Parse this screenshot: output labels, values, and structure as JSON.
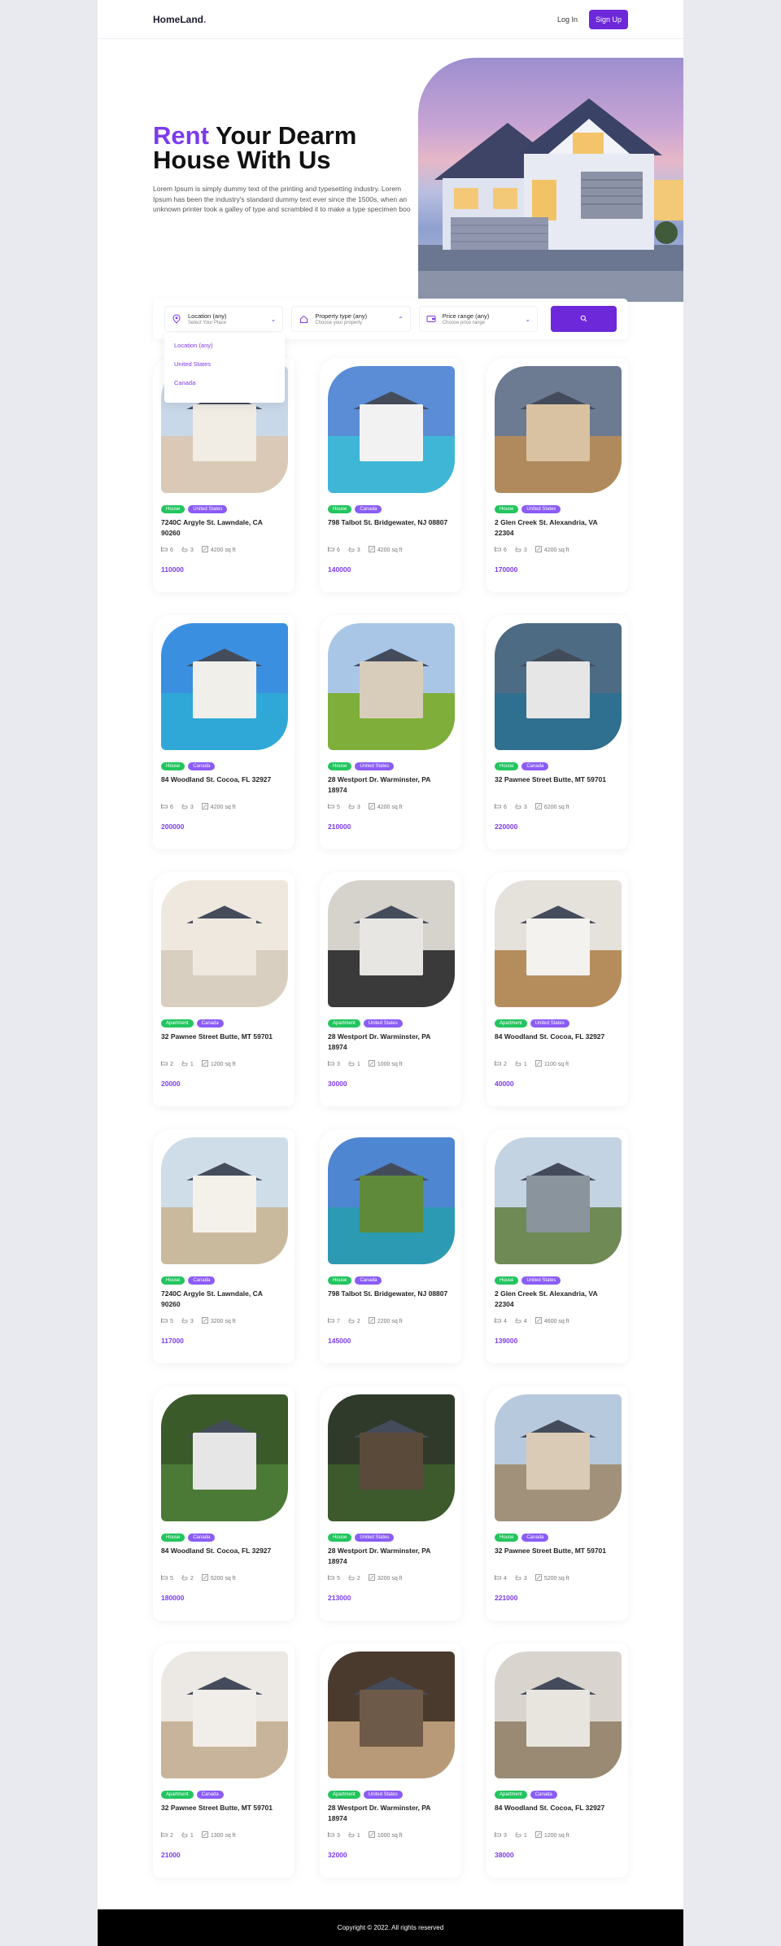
{
  "header": {
    "logo": "HomeLand",
    "logo_dot": ".",
    "login": "Log In",
    "signup": "Sign Up"
  },
  "hero": {
    "title_accent": "Rent",
    "title_rest": " Your Dearm",
    "title_line2": "House With Us",
    "description": "Lorem Ipsum is simply dummy text of the printing and typesetting industry. Lorem Ipsum has been the industry's standard dummy text ever since the 1500s, when an unknown printer took a galley of type and scrambled it to make a type specimen boo"
  },
  "search": {
    "location": {
      "label": "Location (any)",
      "sub": "Select Your Place"
    },
    "property": {
      "label": "Property type (any)",
      "sub": "Choose your property"
    },
    "price": {
      "label": "Price range (any)",
      "sub": "Choose price range"
    },
    "location_options": [
      "Location (any)",
      "United States",
      "Canada"
    ]
  },
  "listings": [
    {
      "type": "House",
      "country": "United States",
      "address": "7240C Argyle St. Lawndale, CA 90260",
      "beds": "6",
      "baths": "3",
      "area": "4200 sq ft",
      "price": "110000",
      "sky": "#c9d8e8",
      "ground": "#d9c9b6",
      "wall": "#f1ece4"
    },
    {
      "type": "House",
      "country": "Canada",
      "address": "798 Talbot St. Bridgewater, NJ 08807",
      "beds": "6",
      "baths": "3",
      "area": "4200 sq ft",
      "price": "140000",
      "sky": "#5b8dd6",
      "ground": "#3fb6d6",
      "wall": "#f2f2f2"
    },
    {
      "type": "House",
      "country": "United States",
      "address": "2 Glen Creek St. Alexandria, VA 22304",
      "beds": "6",
      "baths": "3",
      "area": "4200 sq ft",
      "price": "170000",
      "sky": "#6c7a92",
      "ground": "#b08a5c",
      "wall": "#d9c2a1"
    },
    {
      "type": "House",
      "country": "Canada",
      "address": "84 Woodland St. Cocoa, FL 32927",
      "beds": "6",
      "baths": "3",
      "area": "4200 sq ft",
      "price": "200000",
      "sky": "#3b8fe0",
      "ground": "#2fa8d8",
      "wall": "#f0efea"
    },
    {
      "type": "House",
      "country": "United States",
      "address": "28 Westport Dr. Warminster, PA 18974",
      "beds": "5",
      "baths": "3",
      "area": "4200 sq ft",
      "price": "210000",
      "sky": "#a9c6e6",
      "ground": "#7fae3a",
      "wall": "#d8cdbb"
    },
    {
      "type": "House",
      "country": "Canada",
      "address": "32 Pawnee Street Butte, MT 59701",
      "beds": "6",
      "baths": "3",
      "area": "6200 sq ft",
      "price": "220000",
      "sky": "#4e6b84",
      "ground": "#2f6f8f",
      "wall": "#e6e6e6"
    },
    {
      "type": "Apartment",
      "country": "Canada",
      "address": "32 Pawnee Street Butte, MT 59701",
      "beds": "2",
      "baths": "1",
      "area": "1200 sq ft",
      "price": "20000",
      "sky": "#efe8df",
      "ground": "#d9cfc1",
      "wall": "#efe8df"
    },
    {
      "type": "Apartment",
      "country": "United States",
      "address": "28 Westport Dr. Warminster, PA 18974",
      "beds": "3",
      "baths": "1",
      "area": "1000 sq ft",
      "price": "30000",
      "sky": "#d6d2cc",
      "ground": "#3a3a3a",
      "wall": "#e8e6e2"
    },
    {
      "type": "Apartment",
      "country": "United States",
      "address": "84 Woodland St. Cocoa, FL 32927",
      "beds": "2",
      "baths": "1",
      "area": "1100 sq ft",
      "price": "40000",
      "sky": "#e5e1db",
      "ground": "#b58d5d",
      "wall": "#f4f2ee"
    },
    {
      "type": "House",
      "country": "Canada",
      "address": "7240C Argyle St. Lawndale, CA 90260",
      "beds": "5",
      "baths": "3",
      "area": "3200 sq ft",
      "price": "117000",
      "sky": "#cfdde9",
      "ground": "#c9b99d",
      "wall": "#f3f1ea"
    },
    {
      "type": "House",
      "country": "Canada",
      "address": "798 Talbot St. Bridgewater, NJ 08807",
      "beds": "7",
      "baths": "2",
      "area": "2200 sq ft",
      "price": "145000",
      "sky": "#4f86d1",
      "ground": "#2c9ab3",
      "wall": "#5f8a3a"
    },
    {
      "type": "House",
      "country": "United States",
      "address": "2 Glen Creek St. Alexandria, VA 22304",
      "beds": "4",
      "baths": "4",
      "area": "4600 sq ft",
      "price": "139000",
      "sky": "#c4d3e2",
      "ground": "#6f8a55",
      "wall": "#8a949c"
    },
    {
      "type": "House",
      "country": "Canada",
      "address": "84 Woodland St. Cocoa, FL 32927",
      "beds": "5",
      "baths": "2",
      "area": "5200 sq ft",
      "price": "180000",
      "sky": "#3a5a2a",
      "ground": "#4b7a36",
      "wall": "#e6e6e6"
    },
    {
      "type": "House",
      "country": "United States",
      "address": "28 Westport Dr. Warminster, PA 18974",
      "beds": "5",
      "baths": "2",
      "area": "3200 sq ft",
      "price": "213000",
      "sky": "#2f3a2a",
      "ground": "#3c5a2c",
      "wall": "#5a4a3a"
    },
    {
      "type": "House",
      "country": "Canada",
      "address": "32 Pawnee Street Butte, MT 59701",
      "beds": "4",
      "baths": "3",
      "area": "5200 sq ft",
      "price": "221000",
      "sky": "#b7c9dd",
      "ground": "#a2917a",
      "wall": "#d9cbb5"
    },
    {
      "type": "Apartment",
      "country": "Canada",
      "address": "32 Pawnee Street Butte, MT 59701",
      "beds": "2",
      "baths": "1",
      "area": "1300 sq ft",
      "price": "21000",
      "sky": "#ece8e3",
      "ground": "#c8b49a",
      "wall": "#f1eee9"
    },
    {
      "type": "Apartment",
      "country": "United States",
      "address": "28 Westport Dr. Warminster, PA 18974",
      "beds": "3",
      "baths": "1",
      "area": "1000 sq ft",
      "price": "32000",
      "sky": "#4a3a2e",
      "ground": "#b89a78",
      "wall": "#6e5a48"
    },
    {
      "type": "Apartment",
      "country": "Canada",
      "address": "84 Woodland St. Cocoa, FL 32927",
      "beds": "3",
      "baths": "1",
      "area": "1200 sq ft",
      "price": "38000",
      "sky": "#d9d5ce",
      "ground": "#9a8a74",
      "wall": "#e8e4de"
    }
  ],
  "footer": {
    "copyright": "Copyright © 2022. All rights reserved"
  }
}
